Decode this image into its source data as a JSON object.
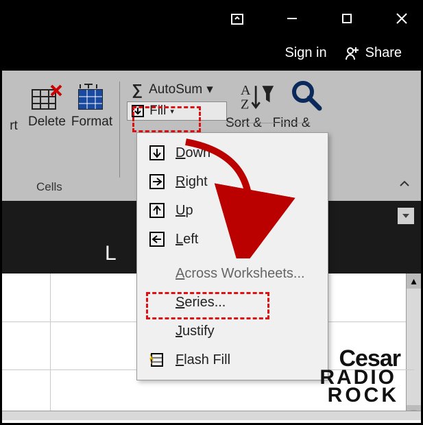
{
  "titlebar": {},
  "account": {
    "signin": "Sign in",
    "share": "Share"
  },
  "ribbon": {
    "insert_label_suffix": "rt",
    "delete_label": "Delete",
    "format_label": "Format",
    "autosum": "AutoSum",
    "fill": "Fill",
    "group_label": "Cells",
    "sortfind": "Sort &   Find &"
  },
  "header_col": "L",
  "fill_menu": {
    "down": "Down",
    "right": "Right",
    "up": "Up",
    "left": "Left",
    "across": "Across Worksheets...",
    "series": "Series...",
    "justify": "Justify",
    "flash": "Flash Fill"
  },
  "watermark": {
    "l1": "Cesar",
    "l2": "RADIO",
    "l3": "ROCK"
  }
}
